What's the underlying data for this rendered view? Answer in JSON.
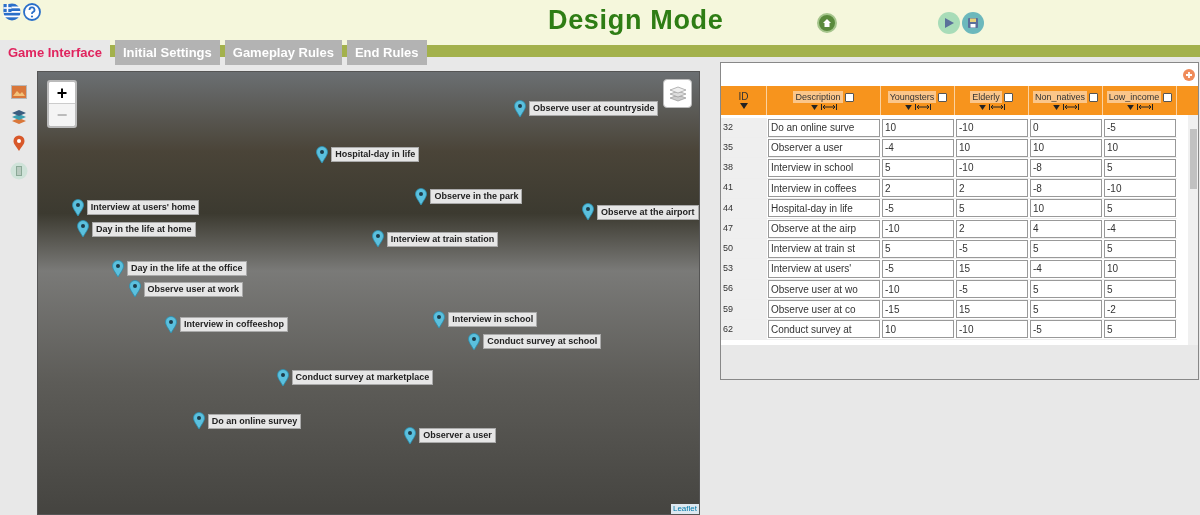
{
  "header": {
    "title": "Design Mode"
  },
  "tabs": [
    {
      "label": "Game Interface",
      "selected": true
    },
    {
      "label": "Initial Settings",
      "selected": false
    },
    {
      "label": "Gameplay Rules",
      "selected": false
    },
    {
      "label": "End Rules",
      "selected": false
    }
  ],
  "map": {
    "zoom_in": {
      "label": "+",
      "disabled": false
    },
    "zoom_out": {
      "label": "−",
      "disabled": true
    },
    "attribution": "Leaflet",
    "markers": [
      {
        "label": "Observe user at countryside"
      },
      {
        "label": "Hospital-day in life"
      },
      {
        "label": "Observe in the park"
      },
      {
        "label": "Observe at the airport"
      },
      {
        "label": "Interview at users' home"
      },
      {
        "label": "Day in the life at home"
      },
      {
        "label": "Interview at train station"
      },
      {
        "label": "Day in the life at the office"
      },
      {
        "label": "Observe user at work"
      },
      {
        "label": "Interview in coffeeshop"
      },
      {
        "label": "Interview in school"
      },
      {
        "label": "Conduct survey at school"
      },
      {
        "label": "Conduct survey at marketplace"
      },
      {
        "label": "Do an online survey"
      },
      {
        "label": "Observer a user"
      }
    ]
  },
  "table": {
    "columns": [
      {
        "label": "ID",
        "kind": "id"
      },
      {
        "label": "Description",
        "kind": "data",
        "checked": false
      },
      {
        "label": "Youngsters",
        "kind": "data",
        "checked": false
      },
      {
        "label": "Elderly",
        "kind": "data",
        "checked": false
      },
      {
        "label": "Non_natives",
        "kind": "data",
        "checked": false
      },
      {
        "label": "Low_income",
        "kind": "data",
        "checked": false
      }
    ],
    "rows": [
      {
        "cells": [
          "32",
          "Do an online surve",
          "10",
          "-10",
          "0",
          "-5"
        ]
      },
      {
        "cells": [
          "35",
          "Observer a user",
          "-4",
          "10",
          "10",
          "10"
        ]
      },
      {
        "cells": [
          "38",
          "Interview in school",
          "5",
          "-10",
          "-8",
          "5"
        ]
      },
      {
        "cells": [
          "41",
          "Interview in coffees",
          "2",
          "2",
          "-8",
          "-10"
        ]
      },
      {
        "cells": [
          "44",
          "Hospital-day in life",
          "-5",
          "5",
          "10",
          "5"
        ]
      },
      {
        "cells": [
          "47",
          "Observe at the airp",
          "-10",
          "2",
          "4",
          "-4"
        ]
      },
      {
        "cells": [
          "50",
          "Interview at train st",
          "5",
          "-5",
          "5",
          "5"
        ]
      },
      {
        "cells": [
          "53",
          "Interview at users'",
          "-5",
          "15",
          "-4",
          "10"
        ]
      },
      {
        "cells": [
          "56",
          "Observe user at wo",
          "-10",
          "-5",
          "5",
          "5"
        ]
      },
      {
        "cells": [
          "59",
          "Observe user at co",
          "-15",
          "15",
          "5",
          "-2"
        ]
      },
      {
        "cells": [
          "62",
          "Conduct survey at",
          "10",
          "-10",
          "-5",
          "5"
        ]
      }
    ]
  }
}
